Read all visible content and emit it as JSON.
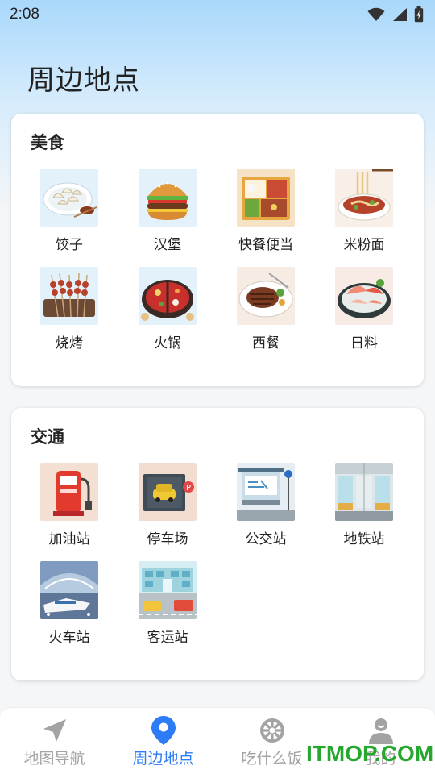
{
  "status_bar": {
    "time": "2:08"
  },
  "page": {
    "title": "周边地点"
  },
  "food": {
    "title": "美食",
    "items": [
      {
        "label": "饺子",
        "icon": "dumplings-icon"
      },
      {
        "label": "汉堡",
        "icon": "burger-icon"
      },
      {
        "label": "快餐便当",
        "icon": "bento-icon"
      },
      {
        "label": "米粉面",
        "icon": "noodles-icon"
      },
      {
        "label": "烧烤",
        "icon": "barbecue-icon"
      },
      {
        "label": "火锅",
        "icon": "hotpot-icon"
      },
      {
        "label": "西餐",
        "icon": "steak-icon"
      },
      {
        "label": "日料",
        "icon": "sashimi-icon"
      }
    ]
  },
  "transit": {
    "title": "交通",
    "items": [
      {
        "label": "加油站",
        "icon": "gas-station-icon"
      },
      {
        "label": "停车场",
        "icon": "parking-icon"
      },
      {
        "label": "公交站",
        "icon": "bus-stop-icon"
      },
      {
        "label": "地铁站",
        "icon": "subway-icon"
      },
      {
        "label": "火车站",
        "icon": "train-station-icon"
      },
      {
        "label": "客运站",
        "icon": "coach-station-icon"
      }
    ]
  },
  "tabs": [
    {
      "label": "地图导航",
      "icon": "navigation-arrow-icon",
      "active": false
    },
    {
      "label": "周边地点",
      "icon": "location-pin-icon",
      "active": true
    },
    {
      "label": "吃什么饭",
      "icon": "wheel-icon",
      "active": false
    },
    {
      "label": "我的",
      "icon": "person-icon",
      "active": false
    }
  ],
  "watermark": "ITMOP.COM",
  "colors": {
    "accent": "#2d7cf6",
    "inactive": "#a3a3a3",
    "watermark": "#26a82f"
  }
}
